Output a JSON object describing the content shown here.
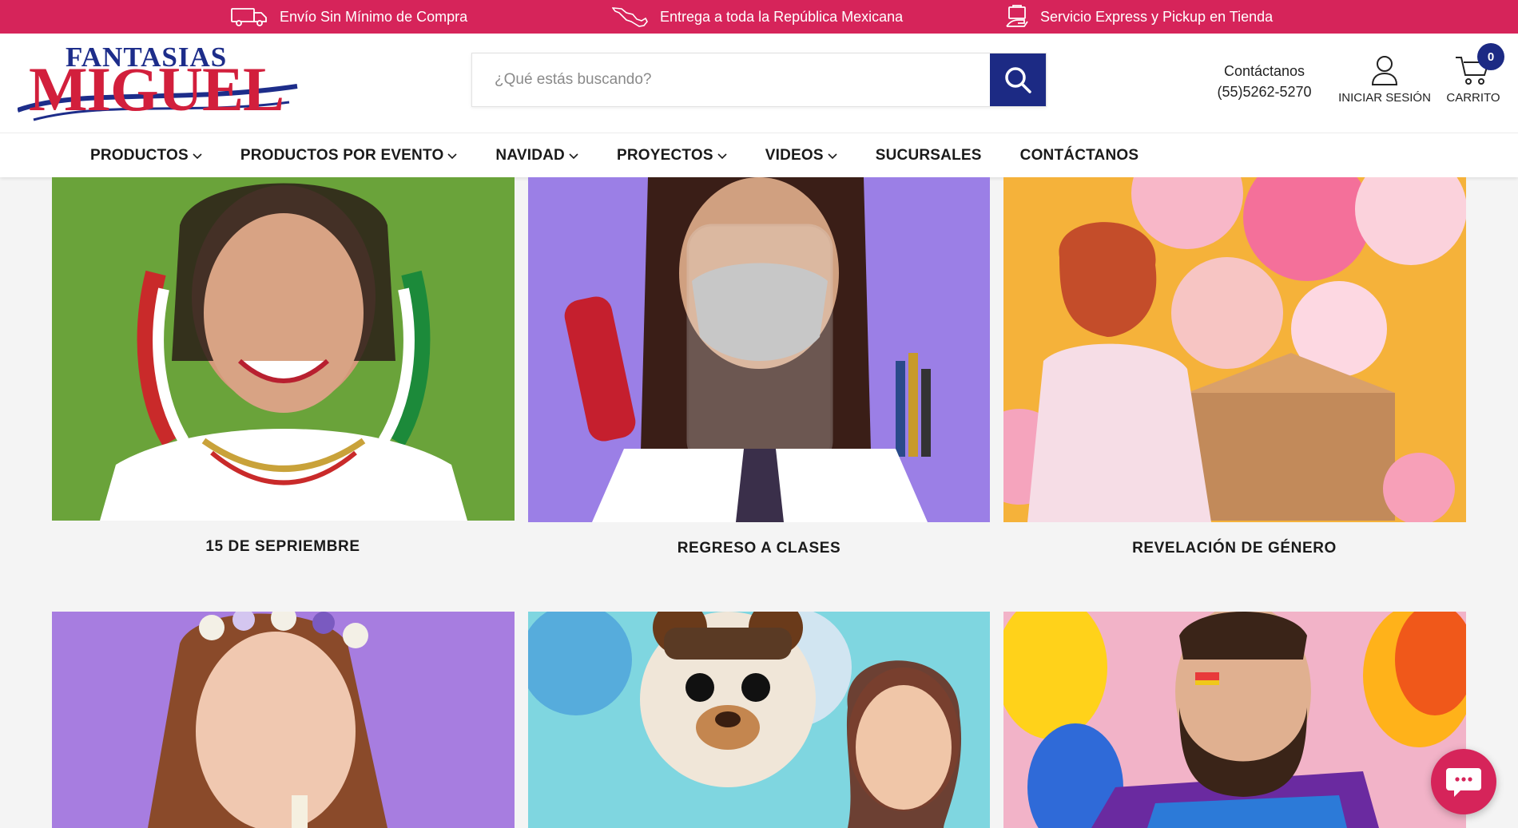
{
  "promo_bar": {
    "items": [
      {
        "label": "Envío Sin Mínimo de Compra",
        "icon": "truck-icon"
      },
      {
        "label": "Entrega a toda la República Mexicana",
        "icon": "mexico-map-icon"
      },
      {
        "label": "Servicio Express y Pickup en Tienda",
        "icon": "store-pickup-icon"
      }
    ],
    "color": "#d6245a"
  },
  "header": {
    "logo_top": "FANTASIAS",
    "logo_main": "MIGUEL",
    "search_placeholder": "¿Qué estás buscando?",
    "contact_label": "Contáctanos",
    "contact_phone": "(55)5262-5270",
    "account_label": "INICIAR SESIÓN",
    "cart_label": "CARRITO",
    "cart_count": "0",
    "accent": "#1c2a84"
  },
  "nav": {
    "items": [
      {
        "label": "PRODUCTOS",
        "dropdown": true
      },
      {
        "label": "PRODUCTOS POR EVENTO",
        "dropdown": true
      },
      {
        "label": "NAVIDAD",
        "dropdown": true
      },
      {
        "label": "PROYECTOS",
        "dropdown": true
      },
      {
        "label": "VIDEOS",
        "dropdown": true
      },
      {
        "label": "SUCURSALES",
        "dropdown": false
      },
      {
        "label": "CONTÁCTANOS",
        "dropdown": false
      }
    ]
  },
  "categories": [
    {
      "label": "15 DE SEPRIEMBRE",
      "bg": "#6aa33a"
    },
    {
      "label": "REGRESO A CLASES",
      "bg": "#9b7fe6"
    },
    {
      "label": "REVELACIÓN DE GÉNERO",
      "bg": "#f5b23a"
    },
    {
      "label": "",
      "bg": "#a77de0"
    },
    {
      "label": "",
      "bg": "#7fd6e0"
    },
    {
      "label": "",
      "bg": "#f2b3c8"
    }
  ]
}
